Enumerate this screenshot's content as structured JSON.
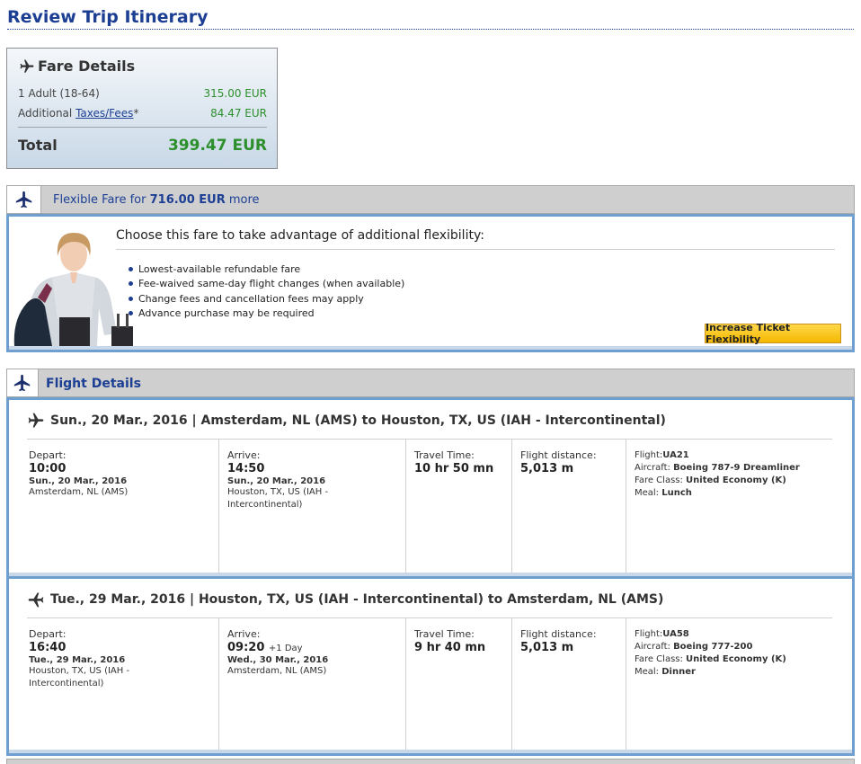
{
  "page": {
    "title": "Review Trip Itinerary"
  },
  "fare": {
    "title": "Fare Details",
    "rows": [
      {
        "label": "1 Adult (18-64)",
        "amount": "315.00 EUR"
      },
      {
        "label_prefix": "Additional ",
        "link": "Taxes/Fees",
        "label_suffix": "*",
        "amount": "84.47 EUR"
      }
    ],
    "total_label": "Total",
    "total_amount": "399.47 EUR"
  },
  "flexible": {
    "bar_prefix": "Flexible Fare for ",
    "bar_amount": "716.00 EUR",
    "bar_suffix": " more",
    "heading": "Choose this fare to take advantage of additional flexibility:",
    "bullets": [
      "Lowest-available refundable fare",
      "Fee-waived same-day flight changes (when available)",
      "Change fees and cancellation fees may apply",
      "Advance purchase may be required"
    ],
    "button": "Increase Ticket Flexibility"
  },
  "flight_details": {
    "title": "Flight Details",
    "segments": [
      {
        "header": "Sun., 20 Mar., 2016 | Amsterdam, NL (AMS) to Houston, TX, US (IAH - Intercontinental)",
        "depart_label": "Depart:",
        "depart_time": "10:00",
        "depart_date": "Sun., 20 Mar., 2016",
        "depart_city": "Amsterdam, NL (AMS)",
        "arrive_label": "Arrive:",
        "arrive_time": "14:50",
        "arrive_extra": "",
        "arrive_date": "Sun., 20 Mar., 2016",
        "arrive_city": "Houston, TX, US (IAH - Intercontinental)",
        "travel_label": "Travel Time:",
        "travel_time": "10 hr 50 mn",
        "distance_label": "Flight distance:",
        "distance": "5,013 m",
        "flight_label": "Flight:",
        "flight": "UA21",
        "aircraft_label": "Aircraft: ",
        "aircraft": "Boeing 787-9 Dreamliner",
        "class_label": "Fare Class: ",
        "fare_class": "United Economy (K)",
        "meal_label": "Meal: ",
        "meal": "Lunch"
      },
      {
        "header": "Tue., 29 Mar., 2016 | Houston, TX, US (IAH - Intercontinental) to Amsterdam, NL (AMS)",
        "depart_label": "Depart:",
        "depart_time": "16:40",
        "depart_date": "Tue., 29 Mar., 2016",
        "depart_city": "Houston, TX, US (IAH - Intercontinental)",
        "arrive_label": "Arrive:",
        "arrive_time": "09:20",
        "arrive_extra": "+1 Day",
        "arrive_date": "Wed., 30 Mar., 2016",
        "arrive_city": "Amsterdam, NL (AMS)",
        "travel_label": "Travel Time:",
        "travel_time": "9 hr 40 mn",
        "distance_label": "Flight distance:",
        "distance": "5,013 m",
        "flight_label": "Flight:",
        "flight": "UA58",
        "aircraft_label": "Aircraft: ",
        "aircraft": "Boeing 777-200",
        "class_label": "Fare Class: ",
        "fare_class": "United Economy (K)",
        "meal_label": "Meal: ",
        "meal": "Dinner"
      }
    ]
  },
  "icons": {
    "plane": "airplane-icon"
  },
  "colors": {
    "title_blue": "#1c3f94",
    "price_green": "#2c8f2c",
    "panel_blue": "#6f9fcf",
    "button_yellow": "#f4b800"
  }
}
